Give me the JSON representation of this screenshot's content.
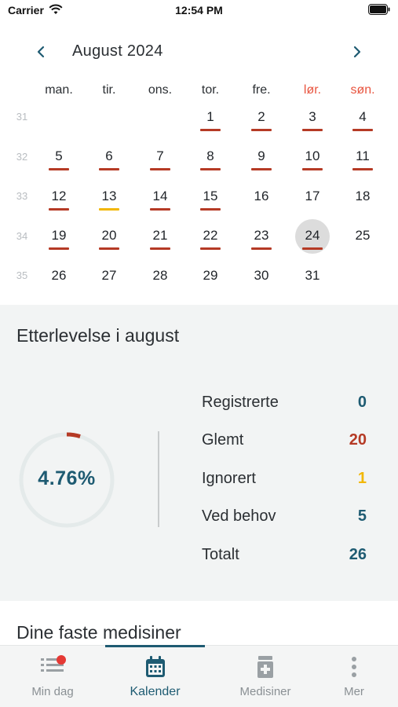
{
  "status_bar": {
    "carrier": "Carrier",
    "time": "12:54 PM"
  },
  "calendar": {
    "month_title": "August 2024",
    "weekdays": [
      "man.",
      "tir.",
      "ons.",
      "tor.",
      "fre.",
      "lør.",
      "søn."
    ],
    "week_numbers": [
      "31",
      "32",
      "33",
      "34",
      "35"
    ],
    "weeks": [
      [
        "",
        "",
        "",
        "1",
        "2",
        "3",
        "4"
      ],
      [
        "5",
        "6",
        "7",
        "8",
        "9",
        "10",
        "11"
      ],
      [
        "12",
        "13",
        "14",
        "15",
        "16",
        "17",
        "18"
      ],
      [
        "19",
        "20",
        "21",
        "22",
        "23",
        "24",
        "25"
      ],
      [
        "26",
        "27",
        "28",
        "29",
        "30",
        "31",
        ""
      ]
    ],
    "day_status": {
      "1": "forgotten",
      "2": "forgotten",
      "3": "forgotten",
      "4": "forgotten",
      "5": "forgotten",
      "6": "forgotten",
      "7": "forgotten",
      "8": "forgotten",
      "9": "forgotten",
      "10": "forgotten",
      "11": "forgotten",
      "12": "forgotten",
      "13": "ignored",
      "14": "forgotten",
      "15": "forgotten",
      "19": "forgotten",
      "20": "forgotten",
      "21": "forgotten",
      "22": "forgotten",
      "23": "forgotten",
      "24": "forgotten"
    },
    "today": "24"
  },
  "compliance": {
    "title": "Etterlevelse i august",
    "percent_label": "4.76%",
    "percent_value": 4.76,
    "stats": [
      {
        "label": "Registrerte",
        "value": "0",
        "color": "#1e5b72"
      },
      {
        "label": "Glemt",
        "value": "20",
        "color": "#b53a25"
      },
      {
        "label": "Ignorert",
        "value": "1",
        "color": "#f2b705"
      },
      {
        "label": "Ved behov",
        "value": "5",
        "color": "#1e5b72"
      },
      {
        "label": "Totalt",
        "value": "26",
        "color": "#1e5b72"
      }
    ]
  },
  "medicines": {
    "title": "Dine faste medisiner"
  },
  "tabbar": {
    "tabs": [
      {
        "label": "Min dag",
        "icon": "list-icon"
      },
      {
        "label": "Kalender",
        "icon": "calendar-icon"
      },
      {
        "label": "Medisiner",
        "icon": "medicine-icon"
      },
      {
        "label": "Mer",
        "icon": "more-icon"
      }
    ],
    "active": "Kalender"
  },
  "colors": {
    "accent": "#1e5b72",
    "forgotten": "#b53a25",
    "ignored": "#f2b705",
    "weekend": "#e8543f",
    "notification": "#e53935"
  }
}
